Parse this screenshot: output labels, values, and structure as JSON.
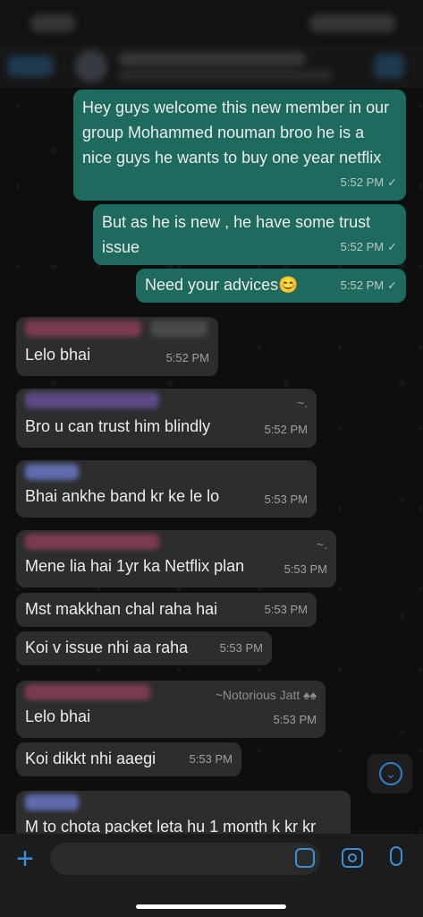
{
  "messages": [
    {
      "type": "out",
      "text": "Hey guys welcome this new member in our group Mohammed nouman broo he is a nice guys he wants to buy one year netflix",
      "time": "5:52 PM"
    },
    {
      "type": "out",
      "text": "But as he is new , he have some trust issue",
      "time": "5:52 PM"
    },
    {
      "type": "out",
      "text": "Need your advices😊",
      "time": "5:52 PM"
    },
    {
      "type": "in",
      "text": "Lelo bhai",
      "time": "5:52 PM"
    },
    {
      "type": "in",
      "text": "Bro u can trust him blindly",
      "time": "5:52 PM",
      "handle": "~."
    },
    {
      "type": "in",
      "text": "Bhai ankhe band kr ke le lo",
      "time": "5:53 PM"
    },
    {
      "type": "in",
      "text": "Mene lia hai 1yr ka Netflix plan",
      "time": "5:53 PM",
      "handle": "~."
    },
    {
      "type": "in",
      "text": "Mst makkhan chal raha hai",
      "time": "5:53 PM"
    },
    {
      "type": "in",
      "text": "Koi v issue nhi aa raha",
      "time": "5:53 PM"
    },
    {
      "type": "in",
      "text": "Lelo bhai",
      "time": "5:53 PM",
      "handle": "~Notorious Jatt ♠♠"
    },
    {
      "type": "in",
      "text": "Koi dikkt nhi aaegi",
      "time": "5:53 PM"
    },
    {
      "type": "in",
      "text": "M to chota packet leta hu 1 month k kr kr"
    }
  ],
  "ui": {
    "tick": "✓",
    "plus": "+",
    "scroll_down": "⌄"
  },
  "icons": [
    "back-icon",
    "group-avatar",
    "video-call-icon",
    "plus-icon",
    "sticker-icon",
    "camera-icon",
    "mic-icon",
    "scroll-down-icon"
  ],
  "colors": {
    "outgoing_bubble": "#1e6a5f",
    "incoming_bubble": "#2d2d2d",
    "accent": "#3a8fd8"
  }
}
